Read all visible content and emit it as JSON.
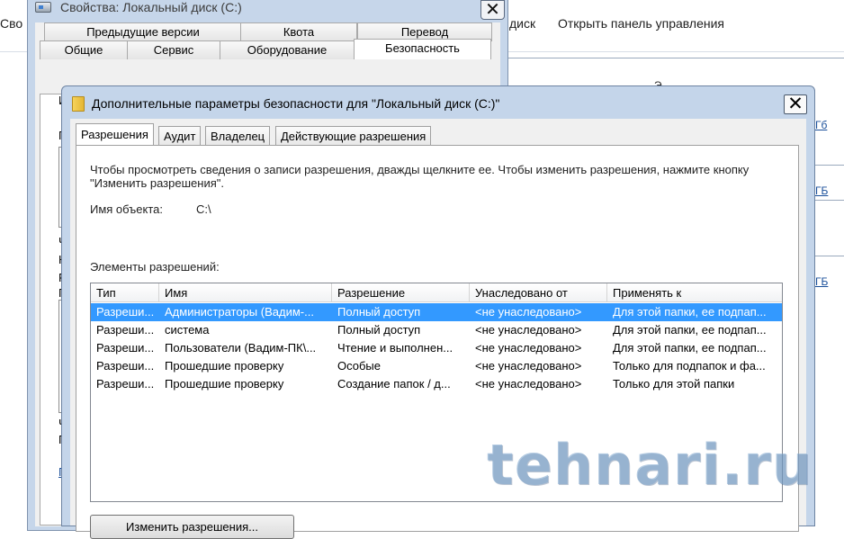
{
  "explorer": {
    "commands": [
      "Сво",
      "диск",
      "Открыть панель управления"
    ],
    "fragments": [
      "Э",
      "Гб",
      "ГБ",
      "ГБ"
    ]
  },
  "properties": {
    "title": "Свойства: Локальный диск (С:)",
    "close": "✕",
    "tabs_row1": [
      "Предыдущие версии",
      "Квота",
      "Перевод"
    ],
    "tabs_row2": [
      "Общие",
      "Сервис",
      "Оборудование",
      "Безопасность"
    ],
    "panel_fragments": [
      "И",
      "С)",
      "Г",
      "Ч",
      "К",
      "Р",
      "Г",
      "Ч",
      "Г",
      "Г"
    ]
  },
  "advanced": {
    "title": "Дополнительные параметры безопасности  для \"Локальный диск (С:)\"",
    "close": "✕",
    "tabs": [
      "Разрешения",
      "Аудит",
      "Владелец",
      "Действующие разрешения"
    ],
    "instructions": "Чтобы просмотреть сведения о записи разрешения, дважды щелкните ее. Чтобы изменить разрешения, нажмите кнопку \"Изменить разрешения\".",
    "object_name_label": "Имя объекта:",
    "object_name_value": "C:\\",
    "entries_label": "Элементы разрешений:",
    "columns": [
      "Тип",
      "Имя",
      "Разрешение",
      "Унаследовано от",
      "Применять к"
    ],
    "rows": [
      [
        "Разреши...",
        "Администраторы (Вадим-...",
        "Полный доступ",
        "<не унаследовано>",
        "Для этой папки, ее подпап..."
      ],
      [
        "Разреши...",
        "система",
        "Полный доступ",
        "<не унаследовано>",
        "Для этой папки, ее подпап..."
      ],
      [
        "Разреши...",
        "Пользователи (Вадим-ПК\\...",
        "Чтение и выполнен...",
        "<не унаследовано>",
        "Для этой папки, ее подпап..."
      ],
      [
        "Разреши...",
        "Прошедшие проверку",
        "Особые",
        "<не унаследовано>",
        "Только для подпапок и фа..."
      ],
      [
        "Разреши...",
        "Прошедшие проверку",
        "Создание папок / д...",
        "<не унаследовано>",
        "Только для этой папки"
      ]
    ],
    "selected_row": 0,
    "change_button": "Изменить разрешения...",
    "selection_color": "#3399ff"
  },
  "watermark": "tehnari.ru"
}
